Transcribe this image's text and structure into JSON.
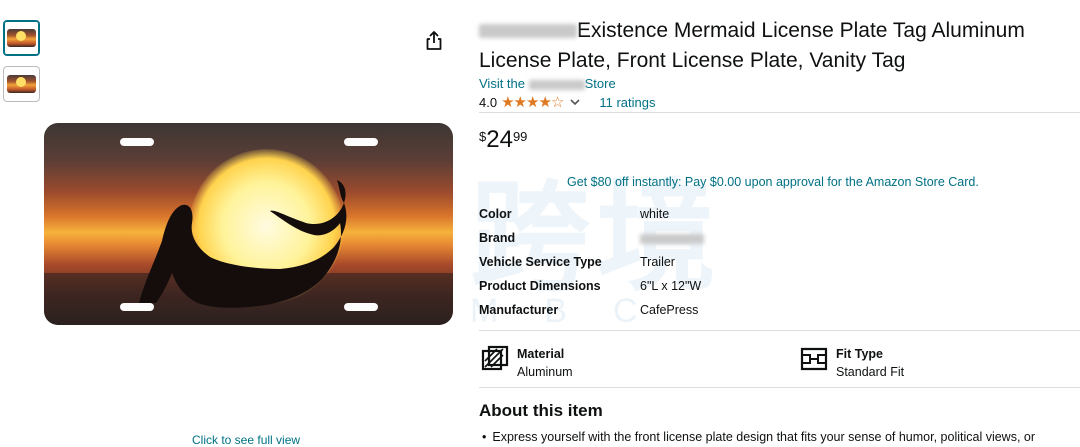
{
  "product": {
    "title_brand_blurred": "",
    "title_text": "Existence Mermaid License Plate Tag Aluminum License Plate, Front License Plate, Vanity Tag",
    "store_prefix": "Visit the",
    "store_suffix": "Store",
    "rating": "4.0",
    "stars_filled": 4,
    "ratings_count": "11 ratings",
    "price_symbol": "$",
    "price_whole": "24",
    "price_fraction": "99",
    "promo": "Get $80 off instantly: Pay $0.00 upon approval for the Amazon Store Card."
  },
  "specs": [
    {
      "key": "Color",
      "value": "white"
    },
    {
      "key": "Brand",
      "value": ""
    },
    {
      "key": "Vehicle Service Type",
      "value": "Trailer"
    },
    {
      "key": "Product Dimensions",
      "value": "6\"L x 12\"W"
    },
    {
      "key": "Manufacturer",
      "value": "CafePress"
    }
  ],
  "features": [
    {
      "label": "Material",
      "value": "Aluminum",
      "icon": "material-icon"
    },
    {
      "label": "Fit Type",
      "value": "Standard Fit",
      "icon": "fit-type-icon"
    }
  ],
  "about": {
    "heading": "About this item",
    "bullets": [
      "Express yourself with the front license plate design that fits your sense of humor, political views, or"
    ]
  },
  "gallery": {
    "click_full_view": "Click to see full view"
  },
  "colors": {
    "link": "#007185",
    "star": "#de7921"
  }
}
